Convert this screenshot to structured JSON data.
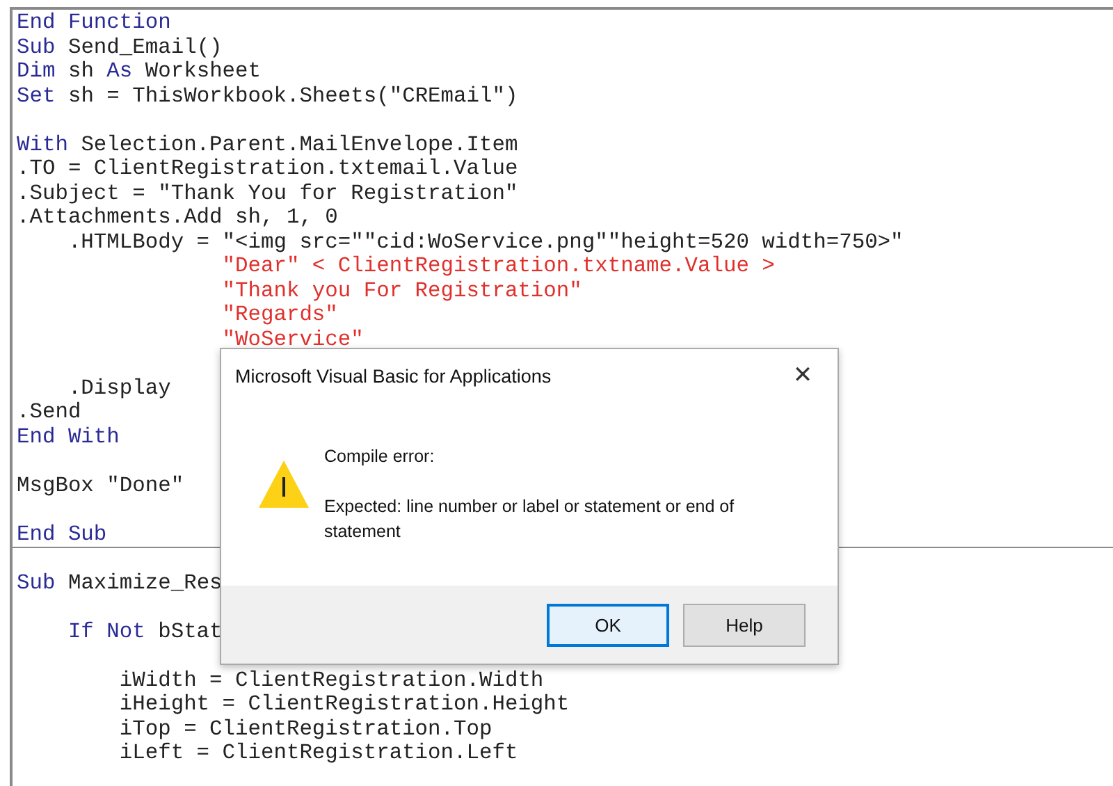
{
  "editor": {
    "lines": [
      {
        "kind": "code",
        "segments": [
          {
            "kind": "keyword",
            "text": "End Function"
          }
        ]
      },
      {
        "kind": "code",
        "segments": [
          {
            "kind": "keyword",
            "text": "Sub"
          },
          {
            "kind": "plain",
            "text": " Send_Email()"
          }
        ]
      },
      {
        "kind": "code",
        "segments": [
          {
            "kind": "keyword",
            "text": "Dim"
          },
          {
            "kind": "plain",
            "text": " sh "
          },
          {
            "kind": "keyword",
            "text": "As"
          },
          {
            "kind": "plain",
            "text": " Worksheet"
          }
        ]
      },
      {
        "kind": "code",
        "segments": [
          {
            "kind": "keyword",
            "text": "Set"
          },
          {
            "kind": "plain",
            "text": " sh = ThisWorkbook.Sheets(\"CREmail\")"
          }
        ]
      },
      {
        "kind": "blank"
      },
      {
        "kind": "code",
        "segments": [
          {
            "kind": "keyword",
            "text": "With"
          },
          {
            "kind": "plain",
            "text": " Selection.Parent.MailEnvelope.Item"
          }
        ]
      },
      {
        "kind": "code",
        "segments": [
          {
            "kind": "plain",
            "text": ".TO = ClientRegistration.txtemail.Value"
          }
        ]
      },
      {
        "kind": "code",
        "segments": [
          {
            "kind": "plain",
            "text": ".Subject = \"Thank You for Registration\""
          }
        ]
      },
      {
        "kind": "code",
        "segments": [
          {
            "kind": "plain",
            "text": ".Attachments.Add sh, 1, 0"
          }
        ]
      },
      {
        "kind": "code",
        "segments": [
          {
            "kind": "plain",
            "text": "    .HTMLBody = \"<img src=\"\"cid:WoService.png\"\"height=520 width=750>\""
          }
        ]
      },
      {
        "kind": "code",
        "segments": [
          {
            "kind": "string",
            "text": "                \"Dear\" < ClientRegistration.txtname.Value >"
          }
        ]
      },
      {
        "kind": "code",
        "segments": [
          {
            "kind": "string",
            "text": "                \"Thank you For Registration\""
          }
        ]
      },
      {
        "kind": "code",
        "segments": [
          {
            "kind": "string",
            "text": "                \"Regards\""
          }
        ]
      },
      {
        "kind": "code",
        "segments": [
          {
            "kind": "string",
            "text": "                \"WoService\""
          }
        ]
      },
      {
        "kind": "blank"
      },
      {
        "kind": "code",
        "segments": [
          {
            "kind": "plain",
            "text": "    .Display"
          }
        ]
      },
      {
        "kind": "code",
        "segments": [
          {
            "kind": "plain",
            "text": ".Send"
          }
        ]
      },
      {
        "kind": "code",
        "segments": [
          {
            "kind": "keyword",
            "text": "End With"
          }
        ]
      },
      {
        "kind": "blank"
      },
      {
        "kind": "code",
        "segments": [
          {
            "kind": "plain",
            "text": "MsgBox \"Done\""
          }
        ]
      },
      {
        "kind": "blank"
      },
      {
        "kind": "code",
        "segments": [
          {
            "kind": "keyword",
            "text": "End Sub"
          }
        ]
      },
      {
        "kind": "separator"
      },
      {
        "kind": "code",
        "segments": [
          {
            "kind": "keyword",
            "text": "Sub"
          },
          {
            "kind": "plain",
            "text": " Maximize_Res"
          }
        ]
      },
      {
        "kind": "blank"
      },
      {
        "kind": "code",
        "segments": [
          {
            "kind": "keyword",
            "text": "    If Not"
          },
          {
            "kind": "plain",
            "text": " bStat"
          }
        ]
      },
      {
        "kind": "blank"
      },
      {
        "kind": "code",
        "segments": [
          {
            "kind": "plain",
            "text": "        iWidth = ClientRegistration.Width"
          }
        ]
      },
      {
        "kind": "code",
        "segments": [
          {
            "kind": "plain",
            "text": "        iHeight = ClientRegistration.Height"
          }
        ]
      },
      {
        "kind": "code",
        "segments": [
          {
            "kind": "plain",
            "text": "        iTop = ClientRegistration.Top"
          }
        ]
      },
      {
        "kind": "code",
        "segments": [
          {
            "kind": "plain",
            "text": "        iLeft = ClientRegistration.Left"
          }
        ]
      }
    ]
  },
  "dialog": {
    "title": "Microsoft Visual Basic for Applications",
    "close": "✕",
    "heading": "Compile error:",
    "message": "Expected: line number or label or statement or end of statement",
    "buttons": [
      {
        "label": "OK",
        "focused": true
      },
      {
        "label": "Help",
        "focused": false
      }
    ]
  }
}
